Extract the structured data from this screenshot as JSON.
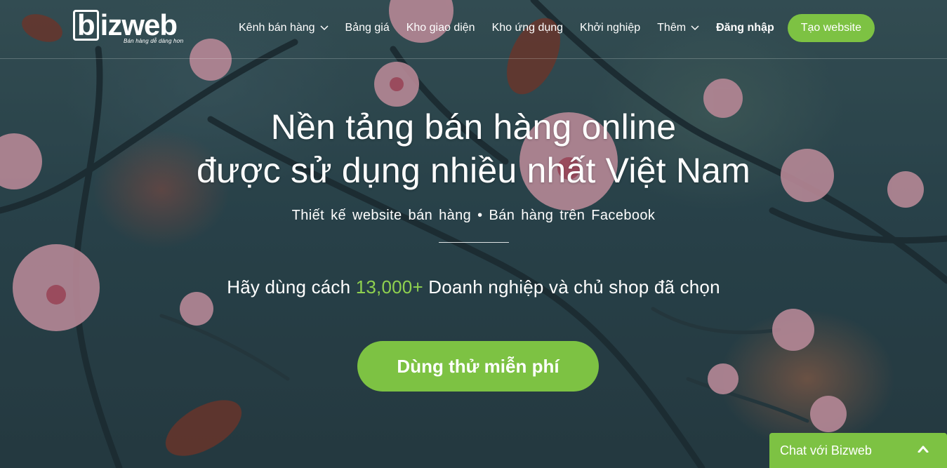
{
  "brand": {
    "name": "bizweb",
    "logo_letter": "b",
    "logo_rest": "izweb",
    "tagline": "Bán hàng dễ dàng hơn",
    "accent_color": "#7dc243"
  },
  "nav": {
    "items": [
      {
        "label": "Kênh bán hàng",
        "has_dropdown": true
      },
      {
        "label": "Bảng giá",
        "has_dropdown": false
      },
      {
        "label": "Kho giao diện",
        "has_dropdown": false
      },
      {
        "label": "Kho ứng dụng",
        "has_dropdown": false
      },
      {
        "label": "Khởi nghiệp",
        "has_dropdown": false
      },
      {
        "label": "Thêm",
        "has_dropdown": true
      }
    ],
    "login_label": "Đăng nhập",
    "cta_label": "Tạo website"
  },
  "hero": {
    "title_line1": "Nền tảng bán hàng online",
    "title_line2": "được sử dụng nhiều nhất Việt Nam",
    "subtitle": "Thiết kế website bán hàng • Bán hàng trên Facebook",
    "claim_prefix": "Hãy dùng cách ",
    "claim_number": "13,000+",
    "claim_suffix": " Doanh nghiệp và chủ shop đã chọn",
    "cta_label": "Dùng thử miễn phí"
  },
  "chat": {
    "label": "Chat với Bizweb",
    "toggle_icon": "chevron-up-icon"
  }
}
